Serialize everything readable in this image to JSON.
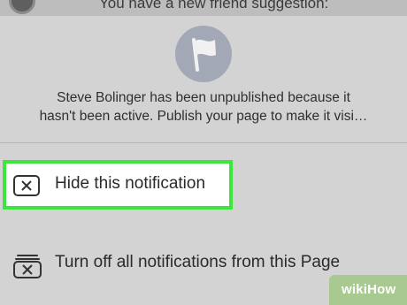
{
  "background_notification": {
    "text": "You have a new friend suggestion:"
  },
  "sheet": {
    "icon": "flag-icon",
    "message_line1": "Steve Bolinger has been unpublished because it",
    "message_line2": "hasn't been active. Publish your page to make it visi…",
    "options": [
      {
        "icon": "close-box-icon",
        "label": "Hide this notification",
        "highlighted": true
      },
      {
        "icon": "stacked-close-icon",
        "label": "Turn off all notifications from this Page",
        "highlighted": false
      }
    ]
  },
  "watermark": {
    "text": "wikiHow"
  },
  "colors": {
    "highlight_border": "#3ce63c",
    "sheet_bg": "#d3d3d3",
    "icon_circle": "#a3a8b7"
  }
}
